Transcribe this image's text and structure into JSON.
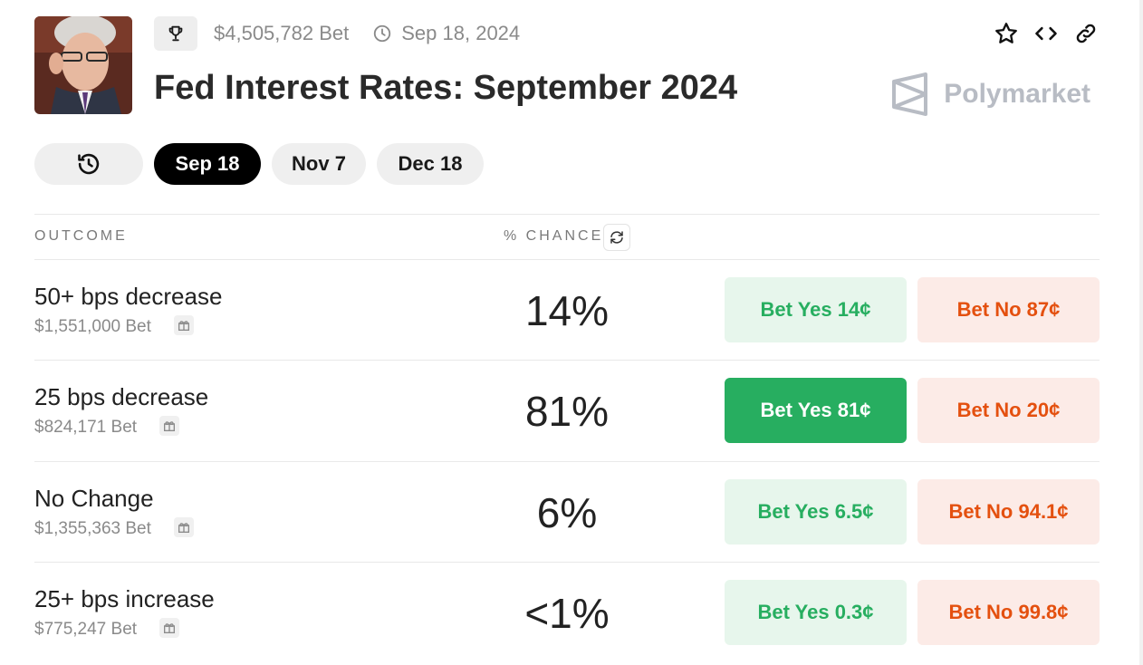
{
  "header": {
    "title": "Fed Interest Rates: September 2024",
    "volume": "$4,505,782 Bet",
    "date": "Sep 18, 2024",
    "brand": "Polymarket"
  },
  "tabs": [
    {
      "label": ""
    },
    {
      "label": "Sep 18"
    },
    {
      "label": "Nov 7"
    },
    {
      "label": "Dec 18"
    }
  ],
  "columns": {
    "outcome": "OUTCOME",
    "chance": "% CHANCE"
  },
  "outcomes": [
    {
      "name": "50+ bps decrease",
      "volume": "$1,551,000 Bet",
      "chance": "14%",
      "yes": "Bet Yes 14¢",
      "no": "Bet No 87¢"
    },
    {
      "name": "25 bps decrease",
      "volume": "$824,171 Bet",
      "chance": "81%",
      "yes": "Bet Yes 81¢",
      "no": "Bet No 20¢"
    },
    {
      "name": "No Change",
      "volume": "$1,355,363 Bet",
      "chance": "6%",
      "yes": "Bet Yes 6.5¢",
      "no": "Bet No 94.1¢"
    },
    {
      "name": "25+ bps increase",
      "volume": "$775,247 Bet",
      "chance": "<1%",
      "yes": "Bet Yes 0.3¢",
      "no": "Bet No 99.8¢"
    }
  ],
  "colors": {
    "yes_text": "#27ae60",
    "yes_bg": "#e7f6ec",
    "yes_strong": "#27ae60",
    "no_text": "#e4500f",
    "no_bg": "#fcebe7",
    "active_tab": "#000000"
  },
  "icons": [
    "trophy-icon",
    "clock-icon",
    "star-icon",
    "code-icon",
    "link-icon",
    "polymarket-logo",
    "history-icon",
    "refresh-icon",
    "gift-icon"
  ]
}
